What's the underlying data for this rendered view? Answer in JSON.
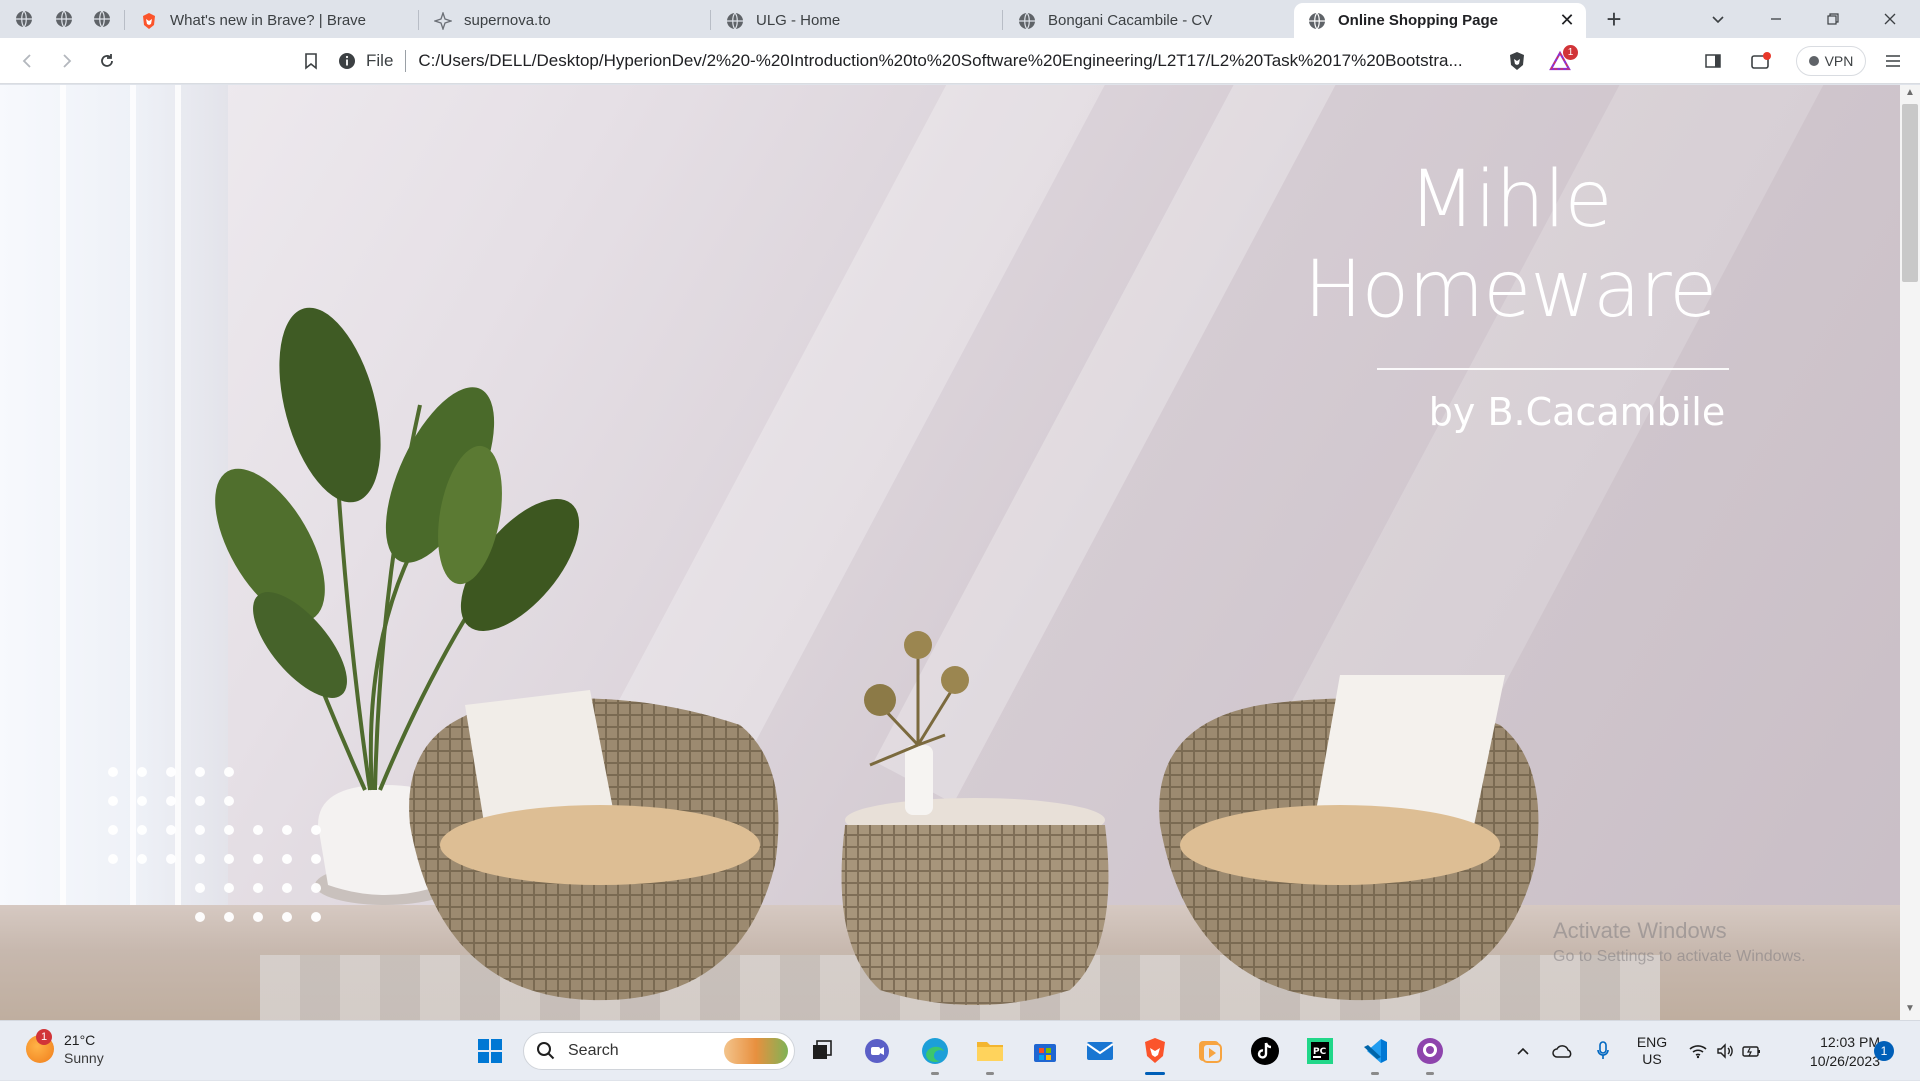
{
  "browser": {
    "tabs": [
      {
        "label": "What's new in Brave? | Brave",
        "icon": "brave-lion-icon"
      },
      {
        "label": "supernova.to",
        "icon": "supernova-icon"
      },
      {
        "label": "ULG - Home",
        "icon": "globe-icon"
      },
      {
        "label": "Bongani Cacambile - CV",
        "icon": "globe-icon"
      },
      {
        "label": "Online Shopping Page",
        "icon": "globe-icon",
        "active": true
      }
    ],
    "pinned_tabs": [
      "globe-icon",
      "globe-icon",
      "globe-icon"
    ],
    "new_tab_symbol": "+",
    "close_symbol": "✕",
    "address": {
      "scheme_label": "File",
      "url": "C:/Users/DELL/Desktop/HyperionDev/2%20-%20Introduction%20to%20Software%20Engineering/L2T17/L2%20Task%2017%20Bootstra..."
    },
    "rewards_badge": "1",
    "vpn_label": "VPN"
  },
  "page": {
    "title_line1": "Mihle",
    "title_line2": "Homeware",
    "subtitle": "by B.Cacambile"
  },
  "watermark": {
    "line1": "Activate Windows",
    "line2": "Go to Settings to activate Windows."
  },
  "taskbar": {
    "weather": {
      "temp": "21°C",
      "condition": "Sunny",
      "badge": "1"
    },
    "search_placeholder": "Search",
    "apps": [
      "windows-start-icon",
      "search-icon",
      "file-explorer-icon",
      "teams-chat-icon",
      "edge-icon",
      "folder-icon",
      "microsoft-store-icon",
      "mail-icon",
      "brave-icon",
      "media-player-icon",
      "tiktok-icon",
      "pycharm-icon",
      "vscode-icon",
      "github-desktop-icon"
    ],
    "language": {
      "line1": "ENG",
      "line2": "US"
    },
    "time": "12:03 PM",
    "date": "10/26/2023",
    "notification_count": "1"
  },
  "colors": {
    "accent_blue": "#005fb8",
    "brave_orange": "#fb542b",
    "hero_text": "#ffffff"
  }
}
